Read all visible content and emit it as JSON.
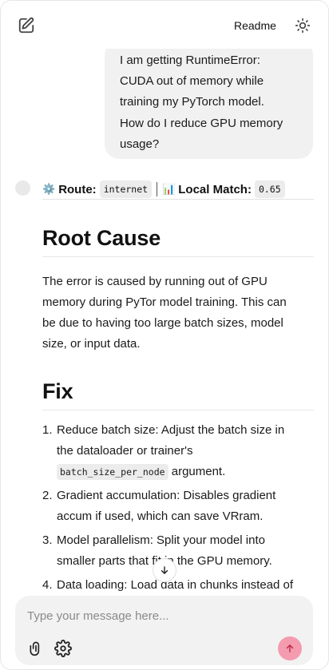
{
  "header": {
    "readme_label": "Readme",
    "icons": {
      "new_chat": "edit-icon",
      "theme": "sun-icon"
    }
  },
  "user_message": {
    "lines": [
      "I am getting RuntimeError:",
      "CUDA out of memory while",
      "training my PyTorch model.",
      "How do I reduce GPU memory",
      "usage?"
    ]
  },
  "assistant": {
    "route": {
      "route_emoji": "⚙️",
      "route_label": "Route:",
      "route_value": "internet",
      "match_emoji": "📊",
      "match_label": "Local Match:",
      "match_value": "0.65"
    },
    "sections": [
      {
        "heading": "Root Cause",
        "paragraph_lines": [
          "The error is caused by running out of GPU",
          "memory during PyTor model training. This can",
          "be due to having too large batch sizes, model",
          "size, or input data."
        ]
      },
      {
        "heading": "Fix",
        "items": [
          {
            "num": "1.",
            "line1": "Reduce batch size: Adjust the batch size in",
            "line2": "the dataloader or trainer's",
            "code": "batch_size_per_node",
            "after_code": " argument."
          },
          {
            "num": "2.",
            "line1": "Gradient accumulation: Disables gradient",
            "line2": "accum if used, which can save VRram."
          },
          {
            "num": "3.",
            "line1": "Model parallelism: Split your model into",
            "line2": "smaller parts that fit in the GPU memory."
          },
          {
            "num": "4.",
            "line1": "Data loading: Load data in chunks instead of",
            "line2": ""
          }
        ]
      }
    ]
  },
  "composer": {
    "placeholder": "Type your message here...",
    "icons": {
      "attach": "paperclip-icon",
      "settings": "gear-icon",
      "send": "arrow-up-icon",
      "scroll": "arrow-down-icon"
    }
  },
  "colors": {
    "send_button": "#f49bb0",
    "bubble": "#f1f1f1",
    "composer": "#f2f2f2"
  }
}
